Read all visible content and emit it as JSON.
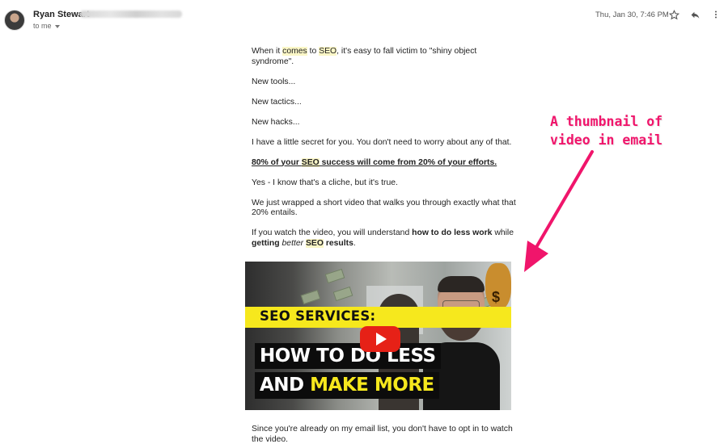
{
  "header": {
    "sender_name": "Ryan Stewart",
    "sender_email_redacted": true,
    "recipient_label": "to me",
    "date": "Thu, Jan 30, 7:46 PM",
    "icons": [
      "star-icon",
      "reply-icon",
      "more-vert-icon"
    ]
  },
  "email": {
    "p1_pre": "When it ",
    "p1_hl1": "comes",
    "p1_mid": " to ",
    "p1_hl2": "SEO",
    "p1_post": ", it's easy to fall victim to \"shiny object syndrome\".",
    "p2": "New tools...",
    "p3": "New tactics...",
    "p4": "New hacks...",
    "p5": "I have a little secret for you. You don't need to worry about any of that.",
    "p6_pre": "80% of your ",
    "p6_hl": "SEO",
    "p6_post": " success will come from 20% of your efforts.",
    "p7": "Yes - I know that's a cliche, but it's true.",
    "p8": "We just wrapped a short video that walks you through exactly what that 20% entails.",
    "p9_pre": "If you watch the video, you will understand ",
    "p9_bold": "how to do less work",
    "p9_mid": " while ",
    "p9_bold2": "getting ",
    "p9_italic": "better",
    "p9_hl": "SEO",
    "p9_bold3": " results",
    "p9_end": ".",
    "p10": "Since you're already on my email list, you don't have to opt in to watch the video."
  },
  "video_thumbnail": {
    "banner": "SEO SERVICES:",
    "title_line1": "HOW TO DO LESS",
    "title_line2_white": "AND ",
    "title_line2_yellow": "MAKE MORE",
    "play_icon": "youtube-play-icon",
    "bag_symbol": "$"
  },
  "annotation": {
    "line1": "A thumbnail of",
    "line2": "video in email",
    "color": "#f0156b"
  },
  "colors": {
    "highlight": "#fbf7c7",
    "youtube_red": "#e62117",
    "banner_yellow": "#f6e81d"
  }
}
